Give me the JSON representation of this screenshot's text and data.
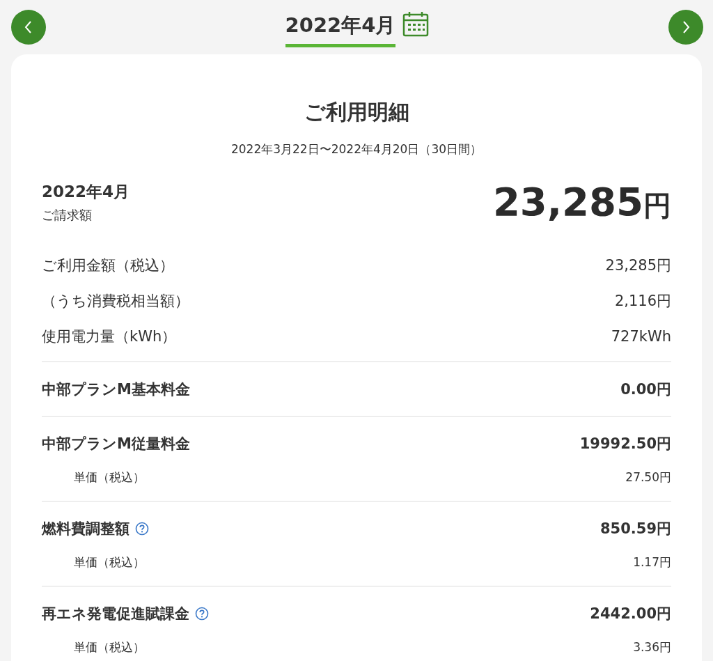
{
  "header": {
    "month": "2022年4月"
  },
  "statement": {
    "title": "ご利用明細",
    "period": "2022年3月22日〜2022年4月20日（30日間）",
    "billing": {
      "month": "2022年4月",
      "label": "ご請求額",
      "amount": "23,285",
      "unit": "円"
    },
    "summary": [
      {
        "label": "ご利用金額（税込）",
        "value": "23,285円"
      },
      {
        "label": "（うち消費税相当額）",
        "value": "2,116円"
      },
      {
        "label": "使用電力量（kWh）",
        "value": "727kWh"
      }
    ],
    "charges": [
      {
        "name": "中部プランM基本料金",
        "amount": "0.00円",
        "help": false
      },
      {
        "name": "中部プランM従量料金",
        "amount": "19992.50円",
        "help": false,
        "unit_label": "単価（税込）",
        "unit_value": "27.50円"
      },
      {
        "name": "燃料費調整額",
        "amount": "850.59円",
        "help": true,
        "unit_label": "単価（税込）",
        "unit_value": "1.17円"
      },
      {
        "name": "再エネ発電促進賦課金",
        "amount": "2442.00円",
        "help": true,
        "unit_label": "単価（税込）",
        "unit_value": "3.36円"
      }
    ]
  }
}
